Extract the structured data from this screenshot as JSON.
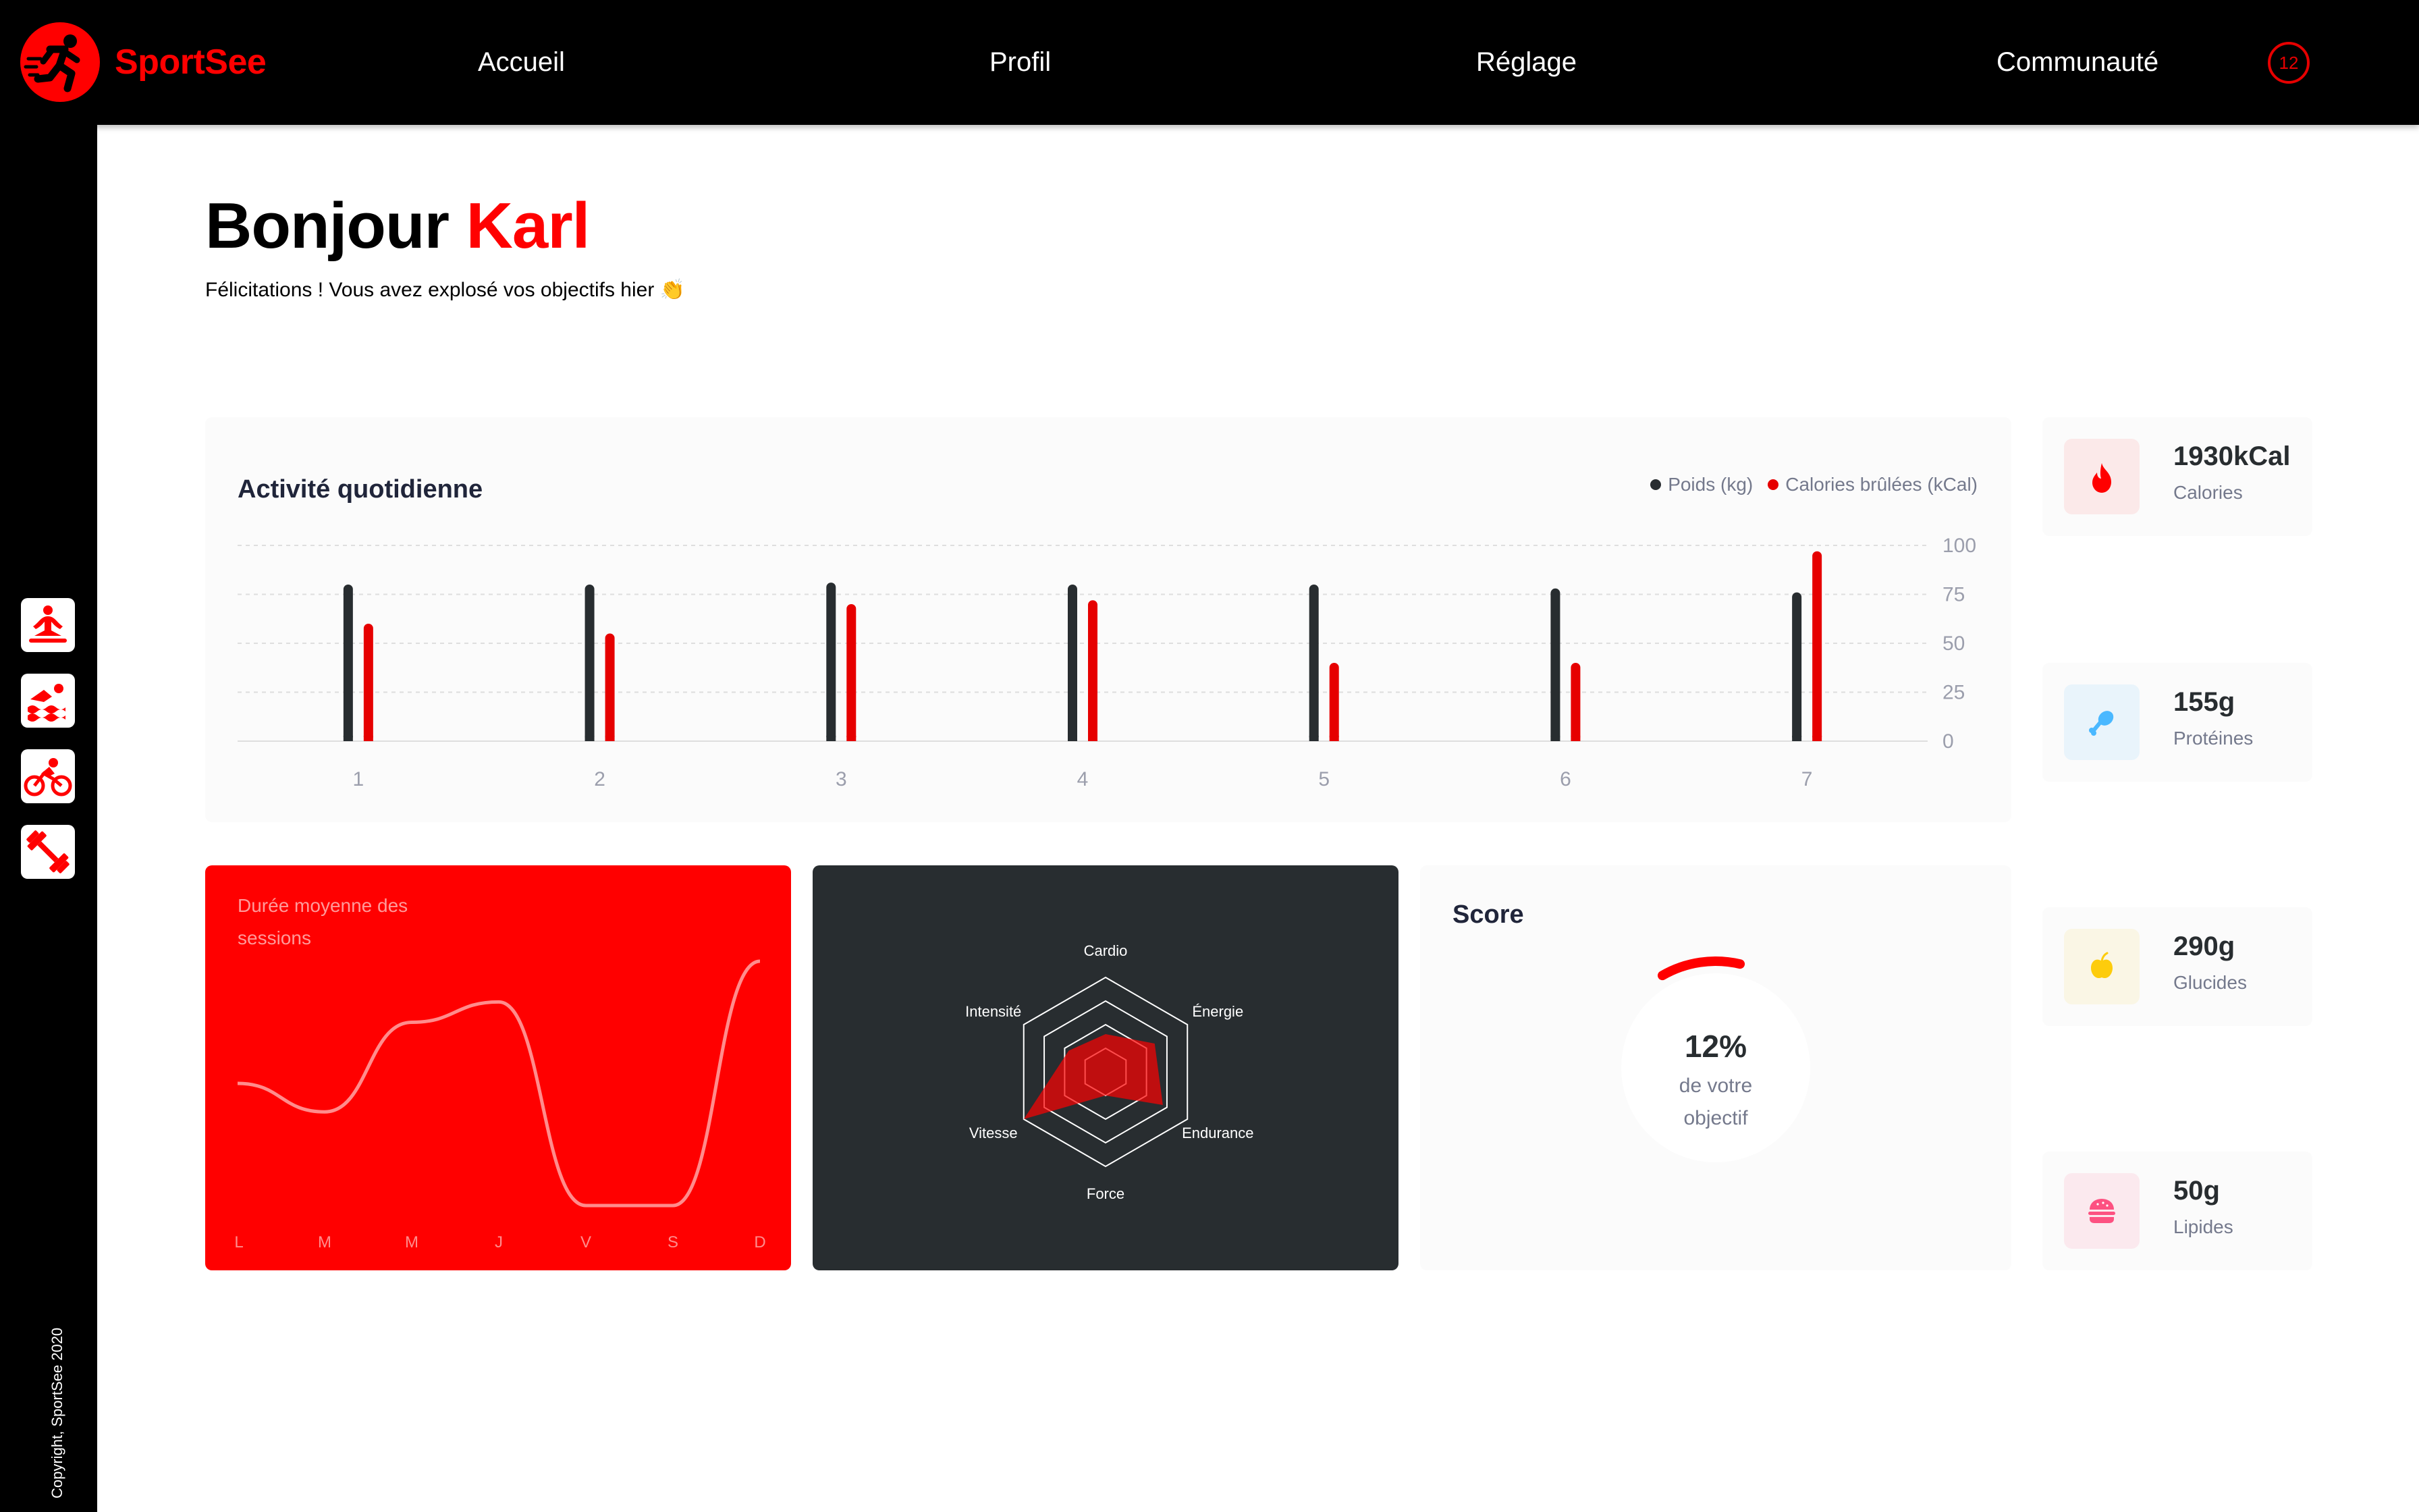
{
  "brand": {
    "name": "SportSee"
  },
  "nav": {
    "items": [
      "Accueil",
      "Profil",
      "Réglage",
      "Communauté"
    ],
    "notification_count": "12"
  },
  "sidebar": {
    "icons": [
      "meditation-icon",
      "swimming-icon",
      "cycling-icon",
      "dumbbell-icon"
    ],
    "copyright": "Copyright, SportSee 2020"
  },
  "greeting": {
    "hello": "Bonjour",
    "name": "Karl",
    "message": "Félicitations ! Vous avez explosé vos objectifs hier 👏"
  },
  "colors": {
    "accent": "#ff0101",
    "dark": "#282d30",
    "muted": "#74798c"
  },
  "activity": {
    "title": "Activité quotidienne",
    "legend": [
      "Poids (kg)",
      "Calories brûlées (kCal)"
    ]
  },
  "sessions": {
    "title": "Durée moyenne des sessions"
  },
  "score": {
    "title": "Score",
    "caption_line1": "de votre",
    "caption_line2": "objectif"
  },
  "kpis": [
    {
      "value": "1930kCal",
      "label": "Calories",
      "icon": "flame-icon",
      "color": "#ff0000"
    },
    {
      "value": "155g",
      "label": "Protéines",
      "icon": "chicken-leg-icon",
      "color": "#4ab8ff"
    },
    {
      "value": "290g",
      "label": "Glucides",
      "icon": "apple-icon",
      "color": "#fdcc0c"
    },
    {
      "value": "50g",
      "label": "Lipides",
      "icon": "burger-icon",
      "color": "#fd5181"
    }
  ],
  "chart_data": [
    {
      "type": "bar",
      "title": "Activité quotidienne",
      "categories": [
        "1",
        "2",
        "3",
        "4",
        "5",
        "6",
        "7"
      ],
      "series": [
        {
          "name": "Poids (kg)",
          "values": [
            80,
            80,
            81,
            80,
            80,
            78,
            76
          ]
        },
        {
          "name": "Calories brûlées (kCal)",
          "values": [
            60,
            55,
            70,
            72,
            40,
            40,
            97
          ]
        }
      ],
      "yticks": [
        "0",
        "25",
        "50",
        "75",
        "100"
      ],
      "ylim": [
        0,
        100
      ],
      "grid": true,
      "legend": "top-right"
    },
    {
      "type": "line",
      "title": "Durée moyenne des sessions",
      "categories": [
        "L",
        "M",
        "M",
        "J",
        "V",
        "S",
        "D"
      ],
      "values": [
        30,
        23,
        45,
        50,
        0,
        0,
        60
      ]
    },
    {
      "type": "radar",
      "axes": [
        "Cardio",
        "Énergie",
        "Endurance",
        "Force",
        "Vitesse",
        "Intensité"
      ],
      "values": [
        80,
        120,
        140,
        50,
        200,
        90
      ],
      "max": 200
    },
    {
      "type": "radial-progress",
      "title": "Score",
      "value": 0.12,
      "label": "12%"
    }
  ]
}
